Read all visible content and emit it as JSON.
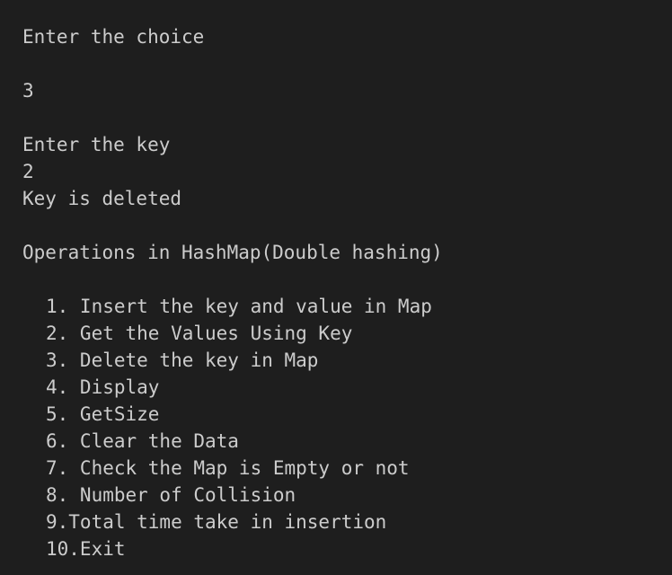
{
  "terminal": {
    "lines": {
      "prompt_choice": "Enter the choice",
      "choice_value": "3",
      "prompt_key": "Enter the key",
      "key_value": "2",
      "result": "Key is deleted",
      "menu_title": "Operations in HashMap(Double hashing)"
    },
    "menu_items": [
      "1. Insert the key and value in Map",
      "2. Get the Values Using Key",
      "3. Delete the key in Map",
      "4. Display",
      "5. GetSize",
      "6. Clear the Data",
      "7. Check the Map is Empty or not",
      "8. Number of Collision",
      "9.Total time take in insertion",
      "10.Exit"
    ],
    "colors": {
      "background": "#1e1e1e",
      "text": "#cccccc"
    }
  }
}
